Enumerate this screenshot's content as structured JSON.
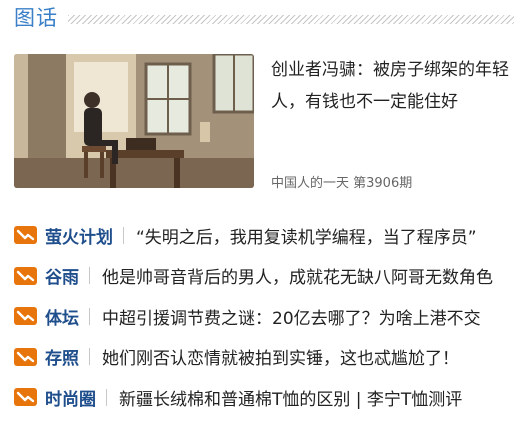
{
  "header": {
    "title": "图话"
  },
  "feature": {
    "title": "创业者冯骕：被房子绑架的年轻人，有钱也不一定能住好",
    "meta": "中国人的一天 第3906期"
  },
  "colors": {
    "accent_orange": "#e8740c",
    "category_blue": "#1f4e8c",
    "header_blue": "#3a7fc8"
  },
  "list": [
    {
      "icon": "orange-link-icon",
      "category": "萤火计划",
      "title": "“失明之后，我用复读机学编程，当了程序员”"
    },
    {
      "icon": "orange-link-icon",
      "category": "谷雨",
      "title": "他是帅哥音背后的男人，成就花无缺八阿哥无数角色"
    },
    {
      "icon": "orange-link-icon",
      "category": "体坛",
      "title": "中超引援调节费之谜：20亿去哪了？为啥上港不交"
    },
    {
      "icon": "orange-link-icon",
      "category": "存照",
      "title": "她们刚否认恋情就被拍到实锤，这也忒尴尬了！"
    },
    {
      "icon": "orange-link-icon",
      "category": "时尚圈",
      "title": "新疆长绒棉和普通棉T恤的区别 | 李宁T恤测评"
    }
  ]
}
